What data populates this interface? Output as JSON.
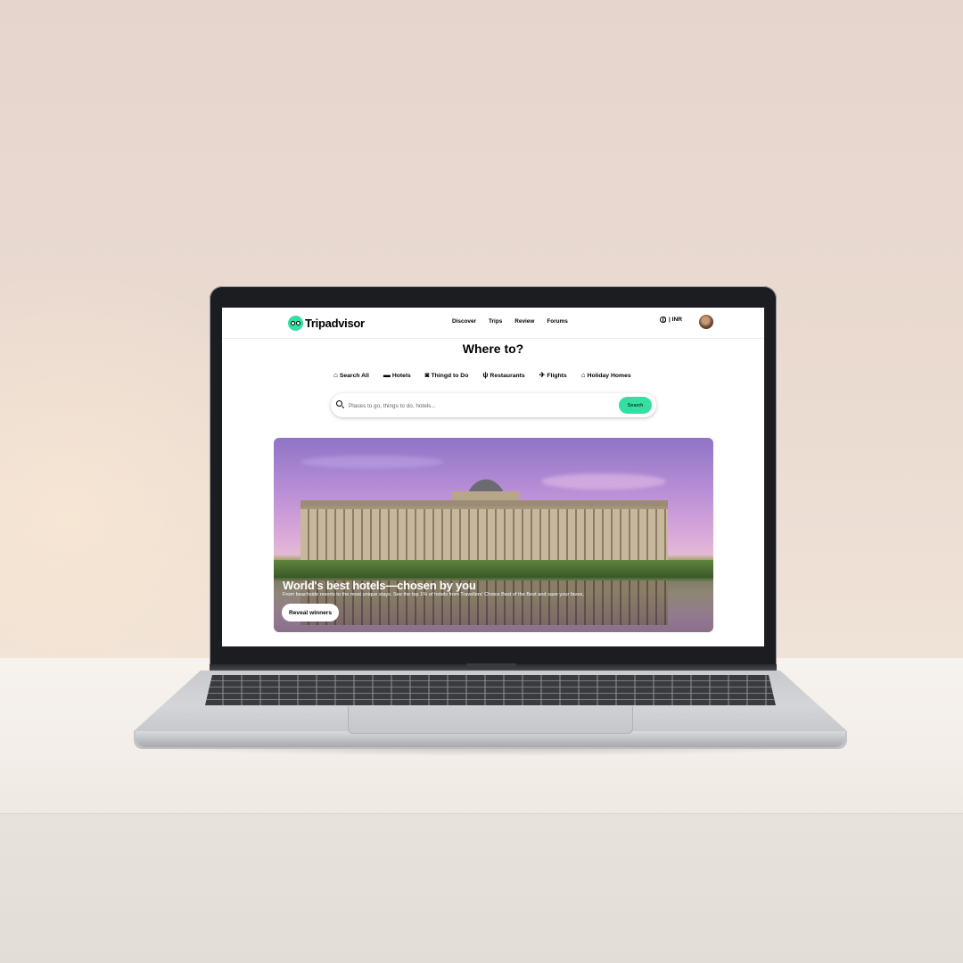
{
  "site": {
    "logo_text": "Tripadvisor",
    "brand_color": "#34e0a1"
  },
  "nav": {
    "links": [
      "Discover",
      "Trips",
      "Review",
      "Forums"
    ],
    "currency": "| INR"
  },
  "hero_search": {
    "headline": "Where to?",
    "categories": [
      {
        "label": "Search All",
        "icon": "home-icon"
      },
      {
        "label": "Hotels",
        "icon": "bed-icon"
      },
      {
        "label": "Thingd to Do",
        "icon": "camera-icon"
      },
      {
        "label": "Restaurants",
        "icon": "cutlery-icon"
      },
      {
        "label": "Flights",
        "icon": "plane-icon"
      },
      {
        "label": "Holiday Homes",
        "icon": "house-icon"
      }
    ],
    "placeholder": "Places to go, things to do, hotels...",
    "button_label": "Search"
  },
  "banner": {
    "title": "World's best hotels—chosen by you",
    "subtitle": "From beachside resorts to the most unique stays. See the top 1% of hotels from Travellers' Choice Best of the Best and save your faves.",
    "button_label": "Reveal winners"
  }
}
